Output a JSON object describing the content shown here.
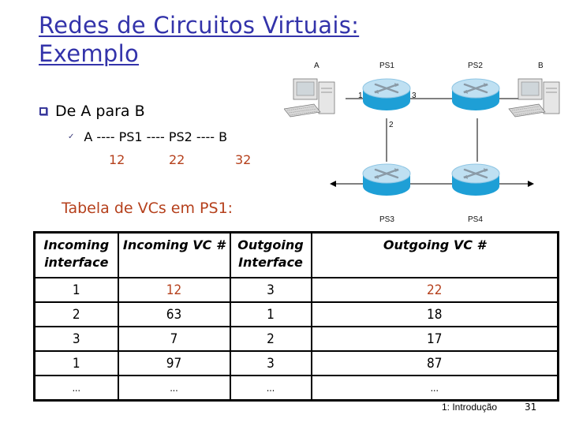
{
  "slide": {
    "title_line1": "Redes de Circuitos Virtuais:",
    "title_line2": "Exemplo",
    "bullet": "De A para B",
    "sub_bullet": "A ---- PS1 ---- PS2 ---- B",
    "vc_numbers": [
      "12",
      "22",
      "32"
    ],
    "table_caption": "Tabela de VCs em PS1:",
    "colors": {
      "title": "#3333aa",
      "accent_red": "#b5401c",
      "router_top": "#bfe0f2",
      "router_side": "#1e9fd6"
    }
  },
  "diagram": {
    "hosts": {
      "left": "A",
      "right": "B"
    },
    "routers": [
      "PS1",
      "PS2",
      "PS3",
      "PS4"
    ],
    "ps1_ports": [
      "1",
      "2",
      "3"
    ]
  },
  "table": {
    "headers": [
      "Incoming interface",
      "Incoming VC #",
      "Outgoing Interface",
      "Outgoing VC #"
    ],
    "header_lines": [
      [
        "Incoming",
        "interface"
      ],
      [
        "Incoming VC #"
      ],
      [
        "Outgoing",
        "Interface"
      ],
      [
        "Outgoing VC #"
      ]
    ],
    "rows": [
      [
        "1",
        "12",
        "3",
        "22"
      ],
      [
        "2",
        "63",
        "1",
        "18"
      ],
      [
        "3",
        "7",
        "2",
        "17"
      ],
      [
        "1",
        "97",
        "3",
        "87"
      ],
      [
        "...",
        "...",
        "...",
        "..."
      ]
    ]
  },
  "footer": {
    "chapter": "1: Introdução",
    "page": "31"
  }
}
